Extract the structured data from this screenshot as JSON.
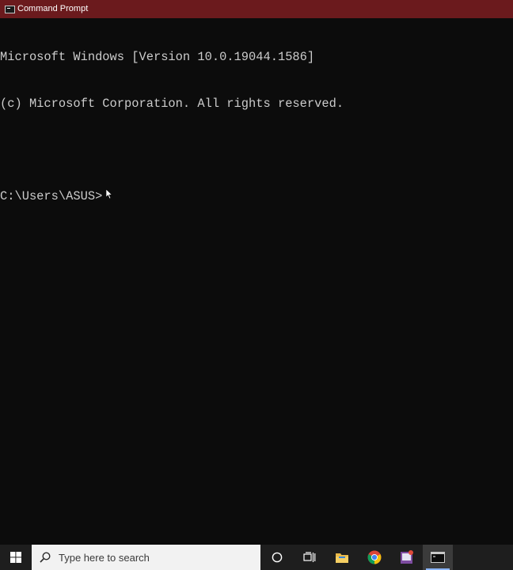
{
  "window": {
    "title": "Command Prompt",
    "icon": "cmd-icon"
  },
  "console": {
    "lines": [
      "Microsoft Windows [Version 10.0.19044.1586]",
      "(c) Microsoft Corporation. All rights reserved.",
      "",
      "C:\\Users\\ASUS>"
    ]
  },
  "taskbar": {
    "search_placeholder": "Type here to search",
    "items": [
      {
        "name": "start-button",
        "icon": "windows-logo-icon"
      },
      {
        "name": "cortana-button",
        "icon": "circle-icon"
      },
      {
        "name": "task-view-button",
        "icon": "task-view-icon"
      },
      {
        "name": "file-explorer-button",
        "icon": "folder-icon"
      },
      {
        "name": "chrome-button",
        "icon": "chrome-icon"
      },
      {
        "name": "app-button",
        "icon": "app-icon"
      },
      {
        "name": "command-prompt-taskbar-button",
        "icon": "terminal-icon",
        "active": true
      }
    ]
  },
  "colors": {
    "titlebar": "#6b1a1d",
    "console_bg": "#0c0c0c",
    "console_text": "#cccccc",
    "taskbar": "#1e1e1e"
  }
}
